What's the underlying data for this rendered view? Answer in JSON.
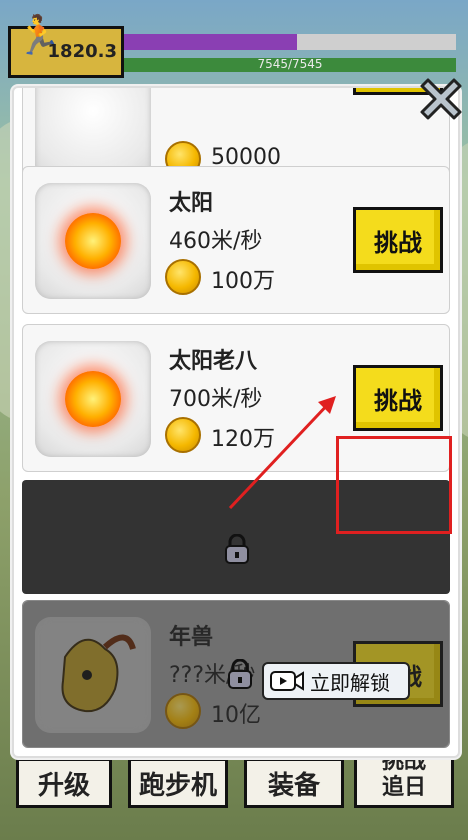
{
  "hud": {
    "score": "1820.3",
    "hp_text": "7545/7545",
    "exp_fraction": 0.52
  },
  "bottom_nav": {
    "upgrade": "升级",
    "treadmill": "跑步机",
    "equipment": "装备",
    "challenge_back": "挑战\n追日"
  },
  "dialog": {
    "items": [
      {
        "name": "",
        "speed": "",
        "price": "50000",
        "button": ""
      },
      {
        "name": "太阳",
        "speed": "460米/秒",
        "price": "100万",
        "button": "挑战"
      },
      {
        "name": "太阳老八",
        "speed": "700米/秒",
        "price": "120万",
        "button": "挑战"
      },
      {
        "name": "年兽",
        "speed": "???米/秒",
        "price": "10亿",
        "button": "挑战"
      }
    ],
    "unlock_label": "立即解锁"
  },
  "colors": {
    "button_yellow": "#f4dc1c",
    "highlight_red": "#e02020",
    "exp_purple": "#8a3fb3"
  },
  "icons": [
    "close-icon",
    "coin-icon",
    "lock-icon",
    "video-icon",
    "sun-icon"
  ]
}
